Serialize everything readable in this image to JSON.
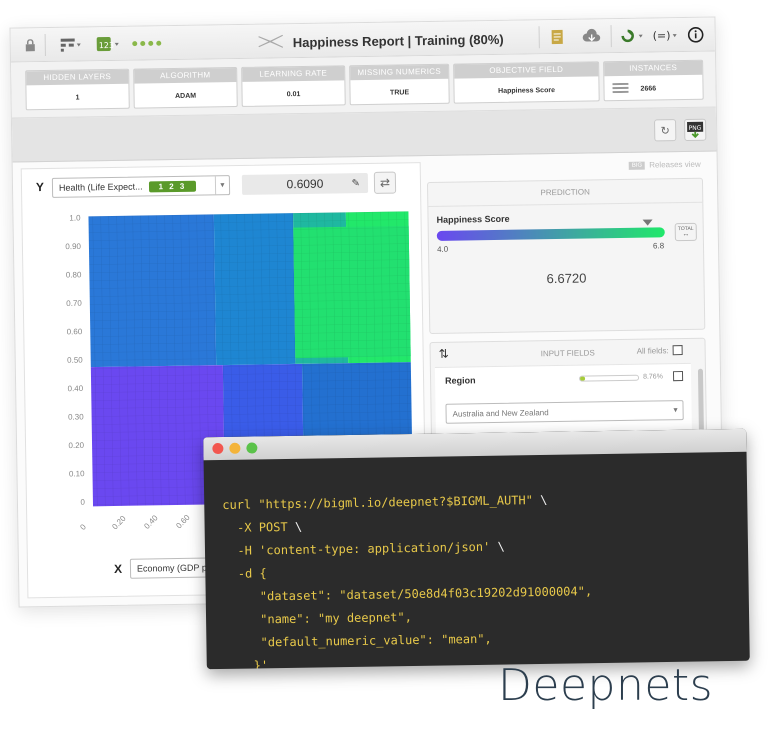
{
  "toolbar": {
    "title": "Happiness Report | Training (80%)",
    "icons": [
      "lock-icon",
      "tree-view-icon",
      "model-type-icon",
      "more-dots-icon",
      "report-icon",
      "cloud-icon",
      "actions-icon",
      "predict-icon",
      "info-icon"
    ]
  },
  "summary": {
    "cards": [
      {
        "header": "HIDDEN LAYERS",
        "value": "1"
      },
      {
        "header": "ALGORITHM",
        "value": "ADAM"
      },
      {
        "header": "LEARNING RATE",
        "value": "0.01"
      },
      {
        "header": "MISSING NUMERICS",
        "value": "TRUE"
      },
      {
        "header": "OBJECTIVE FIELD",
        "value": "Happiness Score"
      },
      {
        "header": "INSTANCES",
        "value": "2666"
      }
    ]
  },
  "chart_controls": {
    "y_label": "Y",
    "y_field": "Health (Life Expect...",
    "y_field_id": "1 2 3",
    "y_value": "0.6090",
    "x_label": "X",
    "x_field": "Economy (GDP pe..."
  },
  "chart_data": {
    "type": "heatmap",
    "y_ticks": [
      "1.0",
      "0.90",
      "0.80",
      "0.70",
      "0.60",
      "0.50",
      "0.40",
      "0.30",
      "0.20",
      "0.10",
      "0"
    ],
    "x_ticks": [
      "0",
      "0.20",
      "0.40",
      "0.60"
    ],
    "ylim": [
      0,
      1
    ],
    "colors": {
      "low": "#6a48f0",
      "mid": "#2a78d8",
      "high": "#22e86a"
    }
  },
  "prediction": {
    "header": "PREDICTION",
    "field": "Happiness Score",
    "min": "4.0",
    "max": "6.8",
    "value": "6.6720",
    "total_label": "TOTAL",
    "gradient_start": "#6a48f0",
    "gradient_end": "#20e86a"
  },
  "input_fields": {
    "header": "INPUT FIELDS",
    "all_fields_label": "All fields:",
    "field_name": "Region",
    "field_percent": "8.76%",
    "select_value": "Australia and New Zealand"
  },
  "releases_label": "Releases view",
  "terminal": {
    "lines": [
      {
        "a": "curl \"https://bigml.io/deepnet?$BIGML_AUTH\" ",
        "b": "\\"
      },
      {
        "a": "  -X POST ",
        "b": "\\"
      },
      {
        "a": "  -H 'content-type: application/json' ",
        "b": "\\"
      },
      {
        "a": "  -d {",
        "b": ""
      },
      {
        "a": "     \"dataset\": \"dataset/50e8d4f03c19202d91000004\",",
        "b": ""
      },
      {
        "a": "     \"name\": \"my deepnet\",",
        "b": ""
      },
      {
        "a": "     \"default_numeric_value\": \"mean\",",
        "b": ""
      },
      {
        "a": "    }'",
        "b": ""
      }
    ]
  },
  "brand": "Deepnets"
}
